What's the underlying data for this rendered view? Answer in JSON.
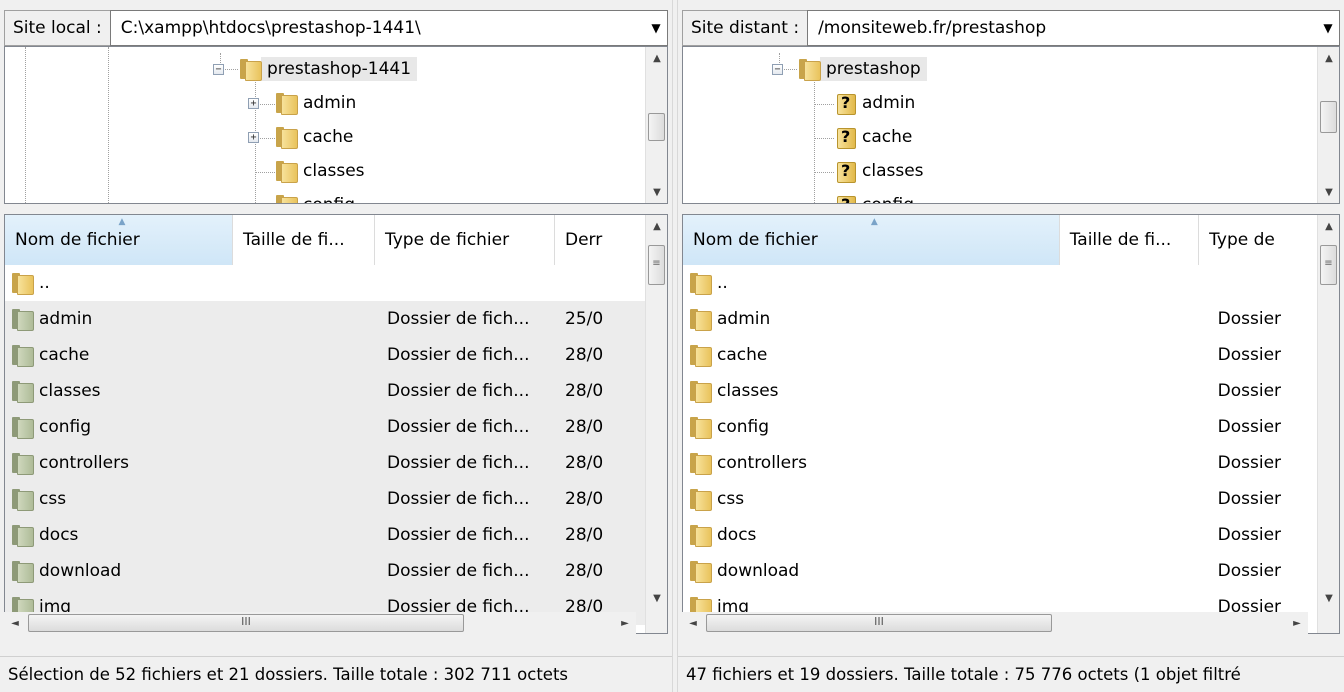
{
  "local": {
    "label": "Site local :",
    "path": "C:\\xampp\\htdocs\\prestashop-1441\\",
    "tree": {
      "root": "prestashop-1441",
      "children": [
        "admin",
        "cache",
        "classes",
        "config"
      ]
    },
    "columns": [
      "Nom de fichier",
      "Taille de fi...",
      "Type de fichier",
      "Derr"
    ],
    "rows": [
      {
        "name": "..",
        "size": "",
        "type": "",
        "date": ""
      },
      {
        "name": "admin",
        "size": "",
        "type": "Dossier de fich...",
        "date": "25/0"
      },
      {
        "name": "cache",
        "size": "",
        "type": "Dossier de fich...",
        "date": "28/0"
      },
      {
        "name": "classes",
        "size": "",
        "type": "Dossier de fich...",
        "date": "28/0"
      },
      {
        "name": "config",
        "size": "",
        "type": "Dossier de fich...",
        "date": "28/0"
      },
      {
        "name": "controllers",
        "size": "",
        "type": "Dossier de fich...",
        "date": "28/0"
      },
      {
        "name": "css",
        "size": "",
        "type": "Dossier de fich...",
        "date": "28/0"
      },
      {
        "name": "docs",
        "size": "",
        "type": "Dossier de fich...",
        "date": "28/0"
      },
      {
        "name": "download",
        "size": "",
        "type": "Dossier de fich...",
        "date": "28/0"
      },
      {
        "name": "img",
        "size": "",
        "type": "Dossier de fich...",
        "date": "28/0"
      }
    ],
    "status": "Sélection de 52 fichiers et 21 dossiers. Taille totale : 302 711 octets"
  },
  "remote": {
    "label": "Site distant :",
    "path": "/monsiteweb.fr/prestashop",
    "tree": {
      "root": "prestashop",
      "children": [
        "admin",
        "cache",
        "classes",
        "config"
      ]
    },
    "columns": [
      "Nom de fichier",
      "Taille de fi...",
      "Type de"
    ],
    "rows": [
      {
        "name": "..",
        "size": "",
        "type": ""
      },
      {
        "name": "admin",
        "size": "",
        "type": "Dossier"
      },
      {
        "name": "cache",
        "size": "",
        "type": "Dossier"
      },
      {
        "name": "classes",
        "size": "",
        "type": "Dossier"
      },
      {
        "name": "config",
        "size": "",
        "type": "Dossier"
      },
      {
        "name": "controllers",
        "size": "",
        "type": "Dossier"
      },
      {
        "name": "css",
        "size": "",
        "type": "Dossier"
      },
      {
        "name": "docs",
        "size": "",
        "type": "Dossier"
      },
      {
        "name": "download",
        "size": "",
        "type": "Dossier"
      },
      {
        "name": "img",
        "size": "",
        "type": "Dossier"
      }
    ],
    "status": "47 fichiers et 19 dossiers. Taille totale : 75 776 octets (1 objet filtré"
  },
  "scroll_thumb_glyph": "III",
  "colors": {
    "sorted_header": "#cfe6f7",
    "selected_row": "#ececec",
    "folder": "#e9c35c"
  }
}
